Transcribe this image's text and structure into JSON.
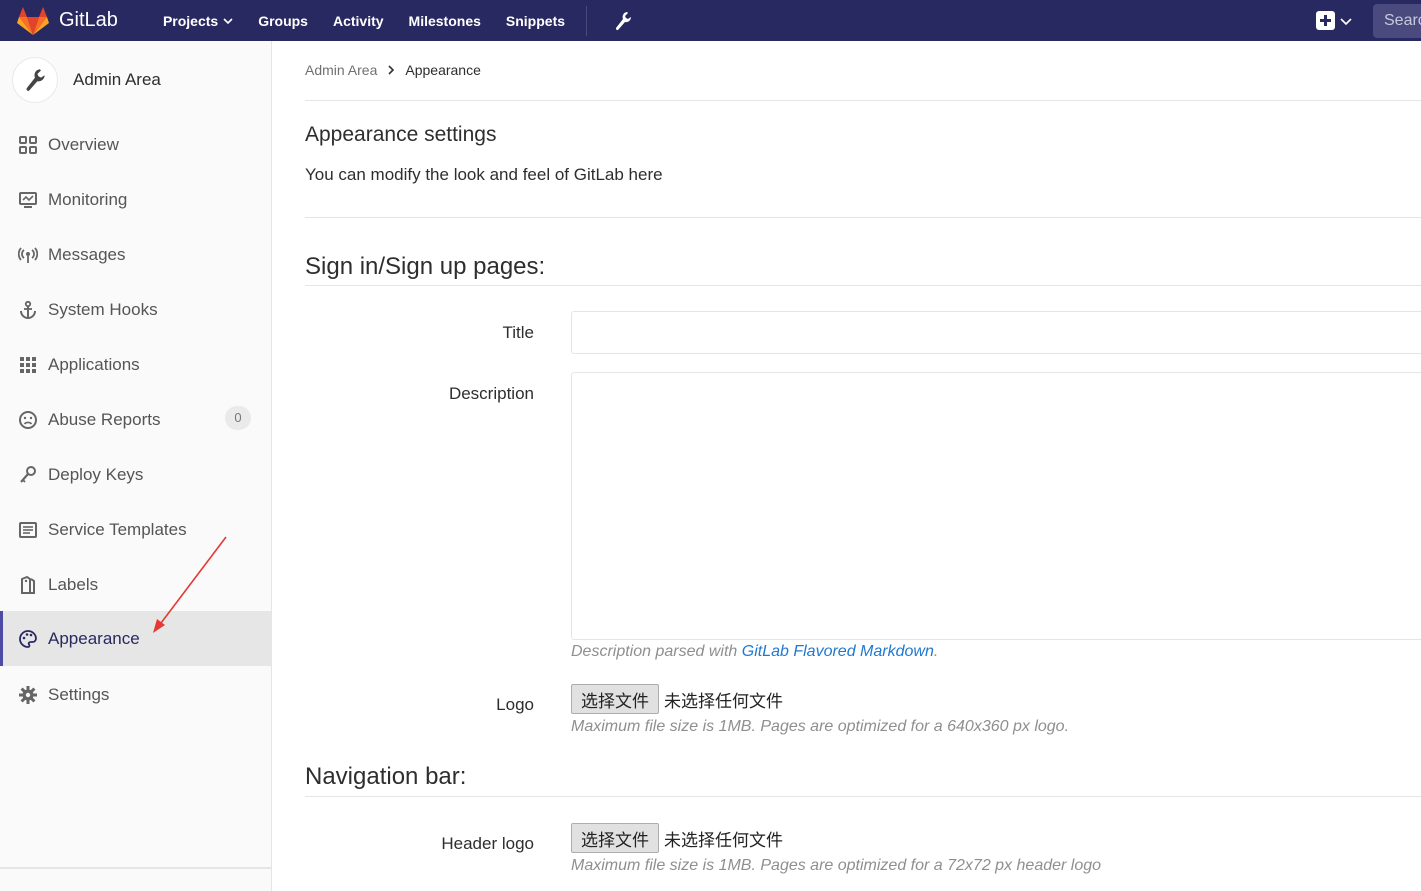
{
  "topbar": {
    "brand": "GitLab",
    "nav": [
      {
        "label": "Projects",
        "dropdown": true
      },
      {
        "label": "Groups"
      },
      {
        "label": "Activity"
      },
      {
        "label": "Milestones"
      },
      {
        "label": "Snippets"
      }
    ],
    "search_placeholder": "Search"
  },
  "sidebar": {
    "title": "Admin Area",
    "items": [
      {
        "label": "Overview",
        "icon": "overview-icon"
      },
      {
        "label": "Monitoring",
        "icon": "monitor-icon"
      },
      {
        "label": "Messages",
        "icon": "broadcast-icon"
      },
      {
        "label": "System Hooks",
        "icon": "anchor-icon"
      },
      {
        "label": "Applications",
        "icon": "grid-icon"
      },
      {
        "label": "Abuse Reports",
        "icon": "frown-icon",
        "badge": "0"
      },
      {
        "label": "Deploy Keys",
        "icon": "key-icon"
      },
      {
        "label": "Service Templates",
        "icon": "template-icon"
      },
      {
        "label": "Labels",
        "icon": "labels-icon"
      },
      {
        "label": "Appearance",
        "icon": "palette-icon",
        "active": true
      },
      {
        "label": "Settings",
        "icon": "gear-icon"
      }
    ]
  },
  "breadcrumb": {
    "parent": "Admin Area",
    "current": "Appearance"
  },
  "page": {
    "title": "Appearance settings",
    "description": "You can modify the look and feel of GitLab here"
  },
  "signin_section": {
    "title": "Sign in/Sign up pages:",
    "title_label": "Title",
    "title_value": "",
    "description_label": "Description",
    "description_value": "",
    "description_help_prefix": "Description parsed with ",
    "description_help_link": "GitLab Flavored Markdown",
    "description_help_suffix": ".",
    "logo_label": "Logo",
    "logo_button": "选择文件",
    "logo_status": "未选择任何文件",
    "logo_help": "Maximum file size is 1MB. Pages are optimized for a 640x360 px logo."
  },
  "navbar_section": {
    "title": "Navigation bar:",
    "header_logo_label": "Header logo",
    "header_logo_button": "选择文件",
    "header_logo_status": "未选择任何文件",
    "header_logo_help": "Maximum file size is 1MB. Pages are optimized for a 72x72 px header logo"
  },
  "colors": {
    "navbar": "#292961",
    "accent": "#4b4ba3",
    "link": "#1f78d1",
    "annotation_arrow": "#e53935"
  }
}
